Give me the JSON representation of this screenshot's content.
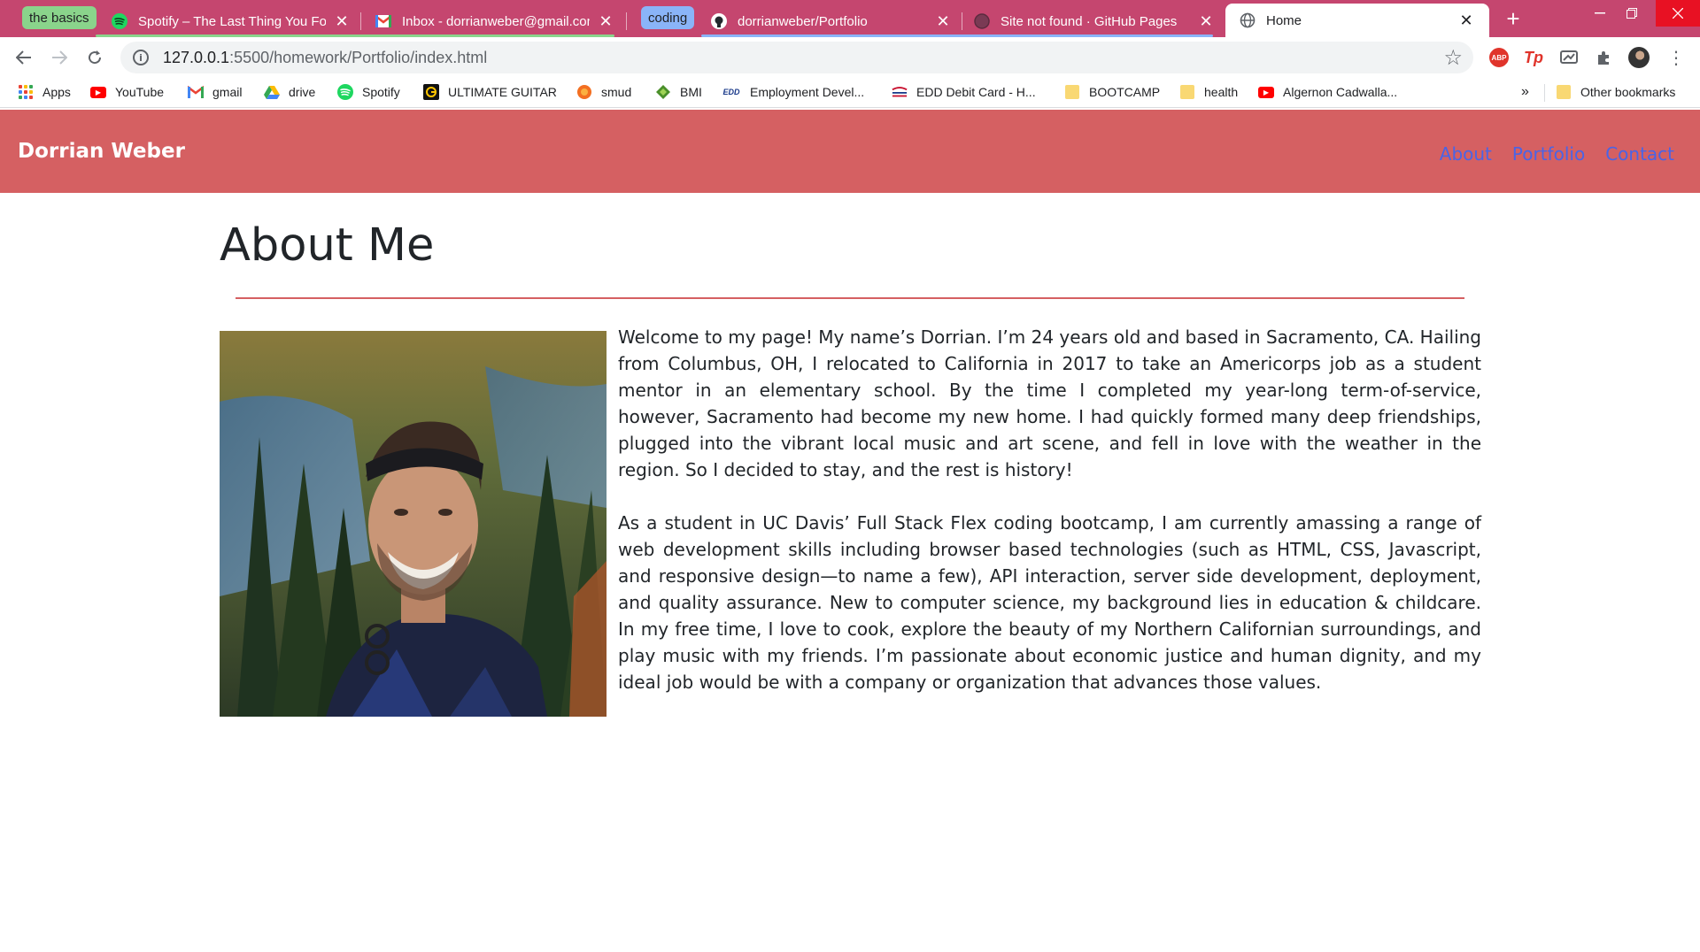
{
  "browser": {
    "tab_groups": [
      {
        "name": "the basics",
        "color": "#8ad48b"
      },
      {
        "name": "coding",
        "color": "#8ab4f8"
      }
    ],
    "tabs": [
      {
        "title": "Spotify – The Last Thing You Forgot",
        "icon": "spotify-icon"
      },
      {
        "title": "Inbox - dorrianweber@gmail.com",
        "icon": "gmail-icon"
      },
      {
        "title": "dorrianweber/Portfolio",
        "icon": "github-icon"
      },
      {
        "title": "Site not found · GitHub Pages",
        "icon": "globe-icon"
      },
      {
        "title": "Home",
        "icon": "globe-icon",
        "active": true
      }
    ],
    "url_host": "127.0.0.1",
    "url_path": ":5500/homework/Portfolio/index.html",
    "bookmarks": [
      {
        "label": "Apps",
        "icon": "apps-grid-icon"
      },
      {
        "label": "YouTube",
        "icon": "youtube-icon"
      },
      {
        "label": "gmail",
        "icon": "gmail-icon"
      },
      {
        "label": "drive",
        "icon": "drive-icon"
      },
      {
        "label": "Spotify",
        "icon": "spotify-icon"
      },
      {
        "label": "ULTIMATE GUITAR",
        "icon": "ultimate-guitar-icon"
      },
      {
        "label": "smud",
        "icon": "smud-icon"
      },
      {
        "label": "BMI",
        "icon": "bmi-icon"
      },
      {
        "label": "Employment Devel...",
        "icon": "edd-icon"
      },
      {
        "label": "EDD Debit Card - H...",
        "icon": "bank-icon"
      },
      {
        "label": "BOOTCAMP",
        "icon": "folder-icon"
      },
      {
        "label": "health",
        "icon": "folder-icon"
      },
      {
        "label": "Algernon Cadwalla...",
        "icon": "youtube-icon"
      }
    ],
    "bookmarks_overflow": "»",
    "other_bookmarks": "Other bookmarks",
    "new_tab": "+",
    "edd_badge": "EDD",
    "abp_badge": "ABP",
    "tp_badge": "Tp"
  },
  "site": {
    "brand": "Dorrian Weber",
    "nav": [
      "About",
      "Portfolio",
      "Contact"
    ],
    "colors": {
      "accent": "#d56062",
      "link": "#4a64e6"
    }
  },
  "about": {
    "title": "About Me",
    "paragraphs": [
      "Welcome to my page! My name’s Dorrian. I’m 24 years old and based in Sacramento, CA. Hailing from Columbus, OH, I relocated to California in 2017 to take an Americorps job as a student mentor in an elementary school. By the time I completed my year-long term-of-service, however, Sacramento had become my new home. I had quickly formed many deep friendships, plugged into the vibrant local music and art scene, and fell in love with the weather in the region. So I decided to stay, and the rest is history!",
      "As a student in UC Davis’ Full Stack Flex coding bootcamp, I am currently amassing a range of web development skills including browser based technologies (such as HTML, CSS, Javascript, and responsive design—to name a few), API interaction, server side development, deployment, and quality assurance. New to computer science, my background lies in education & childcare. In my free time, I love to cook, explore the beauty of my Northern Californian surroundings, and play music with my friends. I’m passionate about economic justice and human dignity, and my ideal job would be with a company or organization that advances those values."
    ]
  }
}
